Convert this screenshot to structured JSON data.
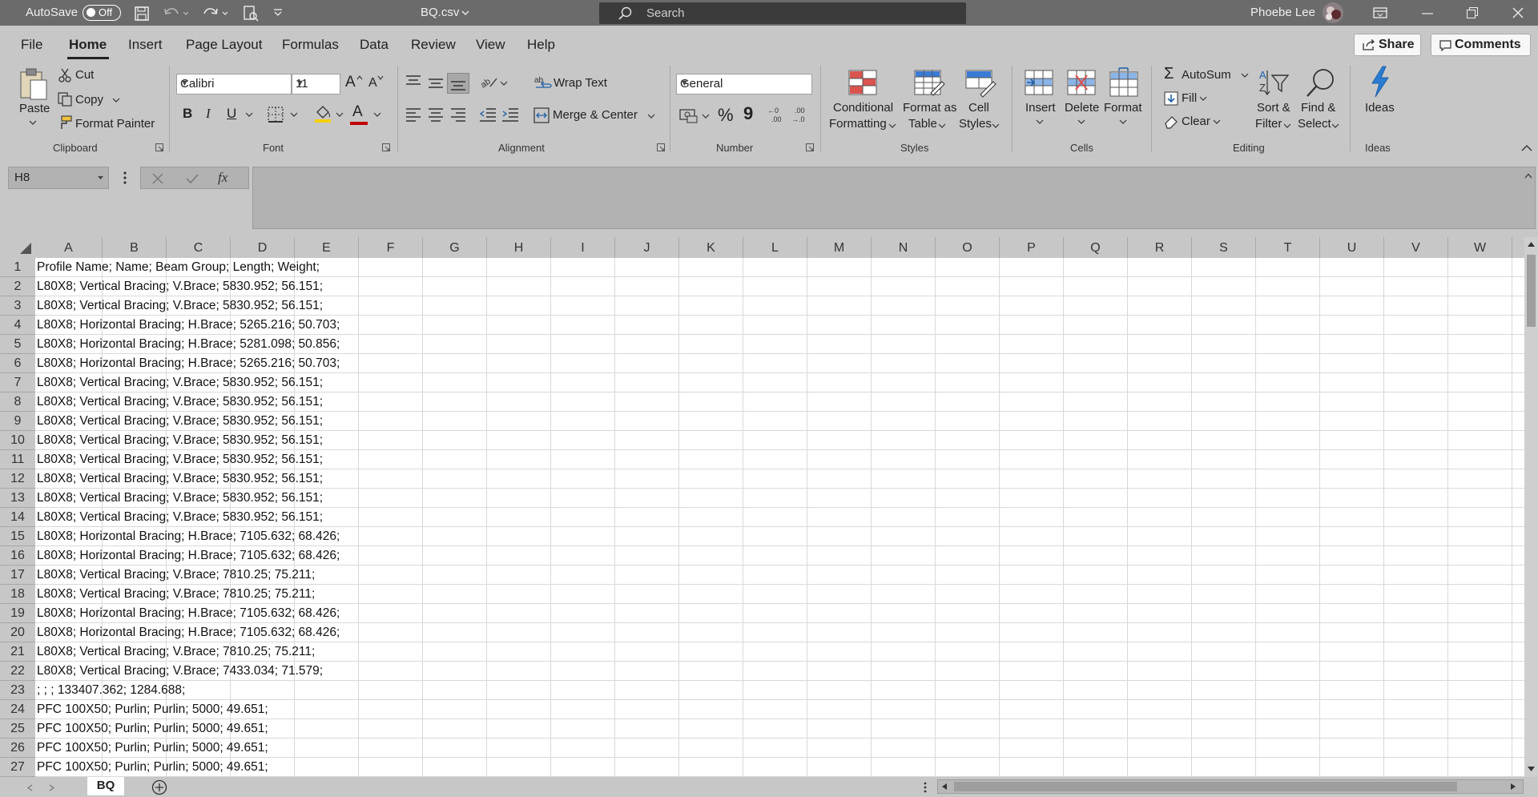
{
  "titlebar": {
    "autosave_label": "AutoSave",
    "autosave_state": "Off",
    "file_name": "BQ.csv",
    "search_placeholder": "Search",
    "user_name": "Phoebe Lee"
  },
  "tabs": [
    "File",
    "Home",
    "Insert",
    "Page Layout",
    "Formulas",
    "Data",
    "Review",
    "View",
    "Help"
  ],
  "active_tab": "Home",
  "share_label": "Share",
  "comments_label": "Comments",
  "ribbon": {
    "clipboard": {
      "label": "Clipboard",
      "paste": "Paste",
      "cut": "Cut",
      "copy": "Copy",
      "format_painter": "Format Painter"
    },
    "font": {
      "label": "Font",
      "family": "Calibri",
      "size": "11",
      "bold": "B",
      "italic": "I",
      "underline": "U",
      "grow": "A",
      "shrink": "A",
      "color_letter": "A"
    },
    "alignment": {
      "label": "Alignment",
      "wrap_text": "Wrap Text",
      "merge_center": "Merge & Center"
    },
    "number": {
      "label": "Number",
      "format": "General",
      "percent": "%",
      "comma": "9"
    },
    "styles": {
      "label": "Styles",
      "conditional_1": "Conditional",
      "conditional_2": "Formatting",
      "format_table_1": "Format as",
      "format_table_2": "Table",
      "cell_styles_1": "Cell",
      "cell_styles_2": "Styles"
    },
    "cells": {
      "label": "Cells",
      "insert": "Insert",
      "delete": "Delete",
      "format": "Format"
    },
    "editing": {
      "label": "Editing",
      "autosum": "AutoSum",
      "fill": "Fill",
      "clear": "Clear",
      "sort_1": "Sort &",
      "sort_2": "Filter",
      "find_1": "Find &",
      "find_2": "Select"
    },
    "ideas": {
      "label": "Ideas",
      "button": "Ideas"
    }
  },
  "namebox": "H8",
  "fx": "fx",
  "columns": [
    "A",
    "B",
    "C",
    "D",
    "E",
    "F",
    "G",
    "H",
    "I",
    "J",
    "K",
    "L",
    "M",
    "N",
    "O",
    "P",
    "Q",
    "R",
    "S",
    "T",
    "U",
    "V",
    "W"
  ],
  "rows": [
    "Profile Name; Name; Beam Group; Length; Weight;",
    "L80X8; Vertical Bracing; V.Brace; 5830.952; 56.151;",
    "L80X8; Vertical Bracing; V.Brace; 5830.952; 56.151;",
    "L80X8; Horizontal Bracing; H.Brace; 5265.216; 50.703;",
    "L80X8; Horizontal Bracing; H.Brace; 5281.098; 50.856;",
    "L80X8; Horizontal Bracing; H.Brace; 5265.216; 50.703;",
    "L80X8; Vertical Bracing; V.Brace; 5830.952; 56.151;",
    "L80X8; Vertical Bracing; V.Brace; 5830.952; 56.151;",
    "L80X8; Vertical Bracing; V.Brace; 5830.952; 56.151;",
    "L80X8; Vertical Bracing; V.Brace; 5830.952; 56.151;",
    "L80X8; Vertical Bracing; V.Brace; 5830.952; 56.151;",
    "L80X8; Vertical Bracing; V.Brace; 5830.952; 56.151;",
    "L80X8; Vertical Bracing; V.Brace; 5830.952; 56.151;",
    "L80X8; Vertical Bracing; V.Brace; 5830.952; 56.151;",
    "L80X8; Horizontal Bracing; H.Brace; 7105.632; 68.426;",
    "L80X8; Horizontal Bracing; H.Brace; 7105.632; 68.426;",
    "L80X8; Vertical Bracing; V.Brace; 7810.25; 75.211;",
    "L80X8; Vertical Bracing; V.Brace; 7810.25; 75.211;",
    "L80X8; Horizontal Bracing; H.Brace; 7105.632; 68.426;",
    "L80X8; Horizontal Bracing; H.Brace; 7105.632; 68.426;",
    "L80X8; Vertical Bracing; V.Brace; 7810.25; 75.211;",
    "L80X8; Vertical Bracing; V.Brace; 7433.034; 71.579;",
    "; ; ; 133407.362; 1284.688;",
    "PFC 100X50; Purlin; Purlin; 5000; 49.651;",
    "PFC 100X50; Purlin; Purlin; 5000; 49.651;",
    "PFC 100X50; Purlin; Purlin; 5000; 49.651;",
    "PFC 100X50; Purlin; Purlin; 5000; 49.651;"
  ],
  "sheet_tab": "BQ"
}
